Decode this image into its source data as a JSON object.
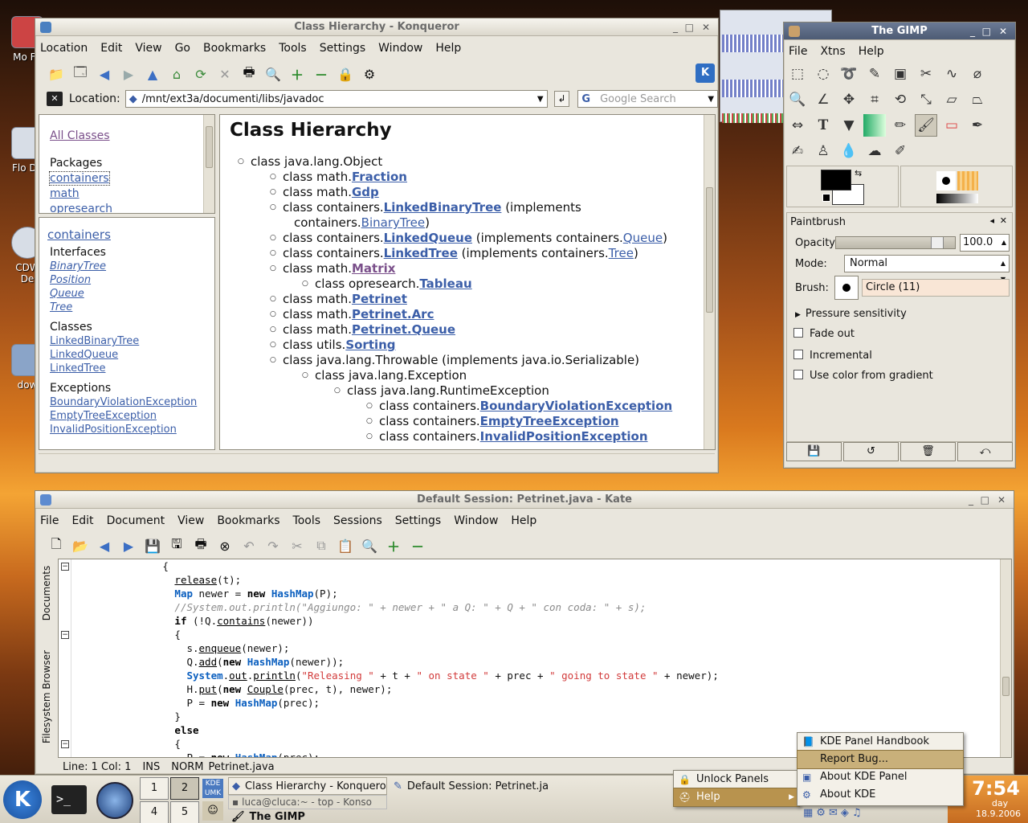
{
  "desktop": {
    "icons": [
      {
        "label": "Mo\nFir"
      },
      {
        "label": "Flo\nDe"
      },
      {
        "label": "CDW\nDe"
      },
      {
        "label": "dow"
      }
    ]
  },
  "konqueror": {
    "title": "Class Hierarchy - Konqueror",
    "menu": [
      "Location",
      "Edit",
      "View",
      "Go",
      "Bookmarks",
      "Tools",
      "Settings",
      "Window",
      "Help"
    ],
    "location_label": "Location:",
    "location_value": "/mnt/ext3a/documenti/libs/javadoc",
    "search_placeholder": "Google Search",
    "frames": {
      "all_classes": "All Classes",
      "packages_heading": "Packages",
      "packages": [
        "containers",
        "math",
        "opresearch"
      ],
      "package_title": "containers",
      "interfaces_heading": "Interfaces",
      "interfaces": [
        "BinaryTree",
        "Position",
        "Queue",
        "Tree"
      ],
      "classes_heading": "Classes",
      "classes": [
        "LinkedBinaryTree",
        "LinkedQueue",
        "LinkedTree"
      ],
      "exceptions_heading": "Exceptions",
      "exceptions": [
        "BoundaryViolationException",
        "EmptyTreeException",
        "InvalidPositionException"
      ]
    },
    "content": {
      "heading": "Class Hierarchy",
      "lines": [
        {
          "level": 0,
          "prefix": "class java.lang.Object",
          "link": "",
          "suffix": ""
        },
        {
          "level": 1,
          "prefix": "class math.",
          "link": "Fraction",
          "suffix": ""
        },
        {
          "level": 1,
          "prefix": "class math.",
          "link": "Gdp",
          "suffix": ""
        },
        {
          "level": 1,
          "prefix": "class containers.",
          "link": "LinkedBinaryTree",
          "suffix": " (implements"
        },
        {
          "level": 1,
          "cont": true,
          "prefix": "containers.",
          "link2": "BinaryTree",
          "suffix": ")"
        },
        {
          "level": 1,
          "prefix": "class containers.",
          "link": "LinkedQueue",
          "suffix": " (implements containers.",
          "link2": "Queue",
          "suffix2": ")"
        },
        {
          "level": 1,
          "prefix": "class containers.",
          "link": "LinkedTree",
          "suffix": " (implements containers.",
          "link2": "Tree",
          "suffix2": ")"
        },
        {
          "level": 1,
          "prefix": "class math.",
          "link": "Matrix",
          "suffix": "",
          "visited": true
        },
        {
          "level": 2,
          "prefix": "class opresearch.",
          "link": "Tableau",
          "suffix": ""
        },
        {
          "level": 1,
          "prefix": "class math.",
          "link": "Petrinet",
          "suffix": ""
        },
        {
          "level": 1,
          "prefix": "class math.",
          "link": "Petrinet.Arc",
          "suffix": ""
        },
        {
          "level": 1,
          "prefix": "class math.",
          "link": "Petrinet.Queue",
          "suffix": ""
        },
        {
          "level": 1,
          "prefix": "class utils.",
          "link": "Sorting",
          "suffix": ""
        },
        {
          "level": 1,
          "prefix": "class java.lang.Throwable (implements java.io.Serializable)",
          "link": "",
          "suffix": ""
        },
        {
          "level": 2,
          "prefix": "class java.lang.Exception",
          "link": "",
          "suffix": ""
        },
        {
          "level": 3,
          "prefix": "class java.lang.RuntimeException",
          "link": "",
          "suffix": ""
        },
        {
          "level": 4,
          "prefix": "class containers.",
          "link": "BoundaryViolationException",
          "suffix": ""
        },
        {
          "level": 4,
          "prefix": "class containers.",
          "link": "EmptyTreeException",
          "suffix": ""
        },
        {
          "level": 4,
          "prefix": "class containers.",
          "link": "InvalidPositionException",
          "suffix": ""
        }
      ]
    }
  },
  "gimp": {
    "title": "The GIMP",
    "menu": [
      "File",
      "Xtns",
      "Help"
    ],
    "tool_options_title": "Paintbrush",
    "opacity_label": "Opacity:",
    "opacity_value": "100.0",
    "mode_label": "Mode:",
    "mode_value": "Normal",
    "brush_label": "Brush:",
    "brush_value": "Circle (11)",
    "pressure": "Pressure sensitivity",
    "options": [
      "Fade out",
      "Incremental",
      "Use color from gradient"
    ],
    "colors": {
      "fg": "#000000",
      "bg": "#ffffff"
    }
  },
  "kate": {
    "title": "Default Session: Petrinet.java - Kate",
    "menu": [
      "File",
      "Edit",
      "Document",
      "View",
      "Bookmarks",
      "Tools",
      "Sessions",
      "Settings",
      "Window",
      "Help"
    ],
    "side_tabs": [
      "Documents",
      "Filesystem Browser"
    ],
    "status": {
      "pos": "Line: 1 Col: 1",
      "ins": "INS",
      "norm": "NORM",
      "file": "Petrinet.java"
    }
  },
  "taskbar": {
    "pager": [
      "1",
      "2",
      "4",
      "5"
    ],
    "tasks": [
      "Class Hierarchy - Konquero",
      "Default Session: Petrinet.ja",
      "luca@cluca:~ - top - Konso",
      "The GIMP"
    ],
    "clock_time": "7:54",
    "clock_day": "day",
    "clock_date": "18.9.2006",
    "kicker_menu": [
      {
        "label": "Unlock Panels"
      },
      {
        "label": "Help"
      }
    ],
    "help_submenu": [
      "KDE Panel Handbook",
      "Report Bug...",
      "About KDE Panel",
      "About KDE"
    ]
  }
}
